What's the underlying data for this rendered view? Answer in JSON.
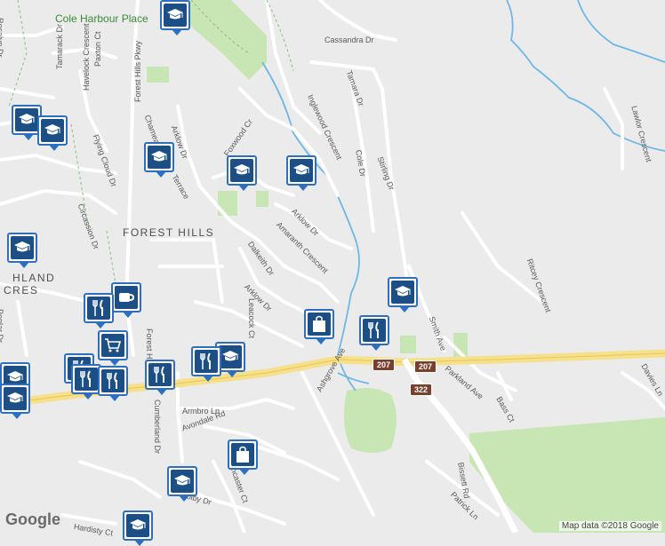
{
  "map": {
    "place_label": "Cole Harbour Place",
    "area_labels": [
      "FOREST HILLS",
      "HLAND",
      "CRES"
    ],
    "street_labels": [
      "Cassandra Dr",
      "Tamara Dr",
      "Inglewood Crescent",
      "Cole Dr",
      "Stirling Dr",
      "Paxton Ct",
      "Havelock Crescent",
      "Forest Hills Pkwy",
      "Tamarack Dr",
      "Flying Cloud Dr",
      "Chameau",
      "Arklow Dr",
      "Foxwood Cr",
      "Terrace",
      "Circassion Dr",
      "Dalkeith Dr",
      "Amaranth Crescent",
      "Arklow Dr",
      "Leacock Ct",
      "Poplar Dr",
      "Arklow Dr",
      "Ashgrove Ave",
      "Armbro Ln",
      "Avondale Rd",
      "Cumberland Dr",
      "Ancaster Ct",
      "Colby Dr",
      "Hardisty Ct",
      "Smith Ave",
      "Parkland Ave",
      "Bass Ct",
      "Ritcey Crescent",
      "Lawlor Crescent",
      "Davies Ln",
      "Bissett Rd",
      "Patrick Ln",
      "Rosalyn Dr",
      "Forest Hills"
    ],
    "route_shields": [
      "207",
      "207",
      "322"
    ],
    "attribution_logo": "Google",
    "credit": "Map data ©2018 Google",
    "colors": {
      "background": "#ebebeb",
      "road": "#ffffff",
      "highway": "#f6e08b",
      "park": "#c8e6b4",
      "water": "#6fb7e6",
      "pin_border": "#2d6fbf",
      "pin_fill": "#1c4f86"
    }
  },
  "markers": [
    {
      "type": "school",
      "icon": "graduation-cap-icon"
    },
    {
      "type": "school",
      "icon": "graduation-cap-icon"
    },
    {
      "type": "school",
      "icon": "graduation-cap-icon"
    },
    {
      "type": "school",
      "icon": "graduation-cap-icon"
    },
    {
      "type": "school",
      "icon": "graduation-cap-icon"
    },
    {
      "type": "school",
      "icon": "graduation-cap-icon"
    },
    {
      "type": "school",
      "icon": "graduation-cap-icon"
    },
    {
      "type": "school",
      "icon": "graduation-cap-icon"
    },
    {
      "type": "school",
      "icon": "graduation-cap-icon"
    },
    {
      "type": "school",
      "icon": "graduation-cap-icon"
    },
    {
      "type": "school",
      "icon": "graduation-cap-icon"
    },
    {
      "type": "school",
      "icon": "graduation-cap-icon"
    },
    {
      "type": "school",
      "icon": "graduation-cap-icon"
    },
    {
      "type": "cafe",
      "icon": "coffee-cup-icon"
    },
    {
      "type": "restaurant",
      "icon": "fork-knife-icon"
    },
    {
      "type": "restaurant",
      "icon": "fork-knife-icon"
    },
    {
      "type": "restaurant",
      "icon": "fork-knife-icon"
    },
    {
      "type": "restaurant",
      "icon": "fork-knife-icon"
    },
    {
      "type": "restaurant",
      "icon": "fork-knife-icon"
    },
    {
      "type": "restaurant",
      "icon": "fork-knife-icon"
    },
    {
      "type": "restaurant",
      "icon": "fork-knife-icon"
    },
    {
      "type": "grocery",
      "icon": "shopping-cart-icon"
    },
    {
      "type": "shopping",
      "icon": "shopping-bag-icon"
    },
    {
      "type": "shopping",
      "icon": "shopping-bag-icon"
    }
  ]
}
